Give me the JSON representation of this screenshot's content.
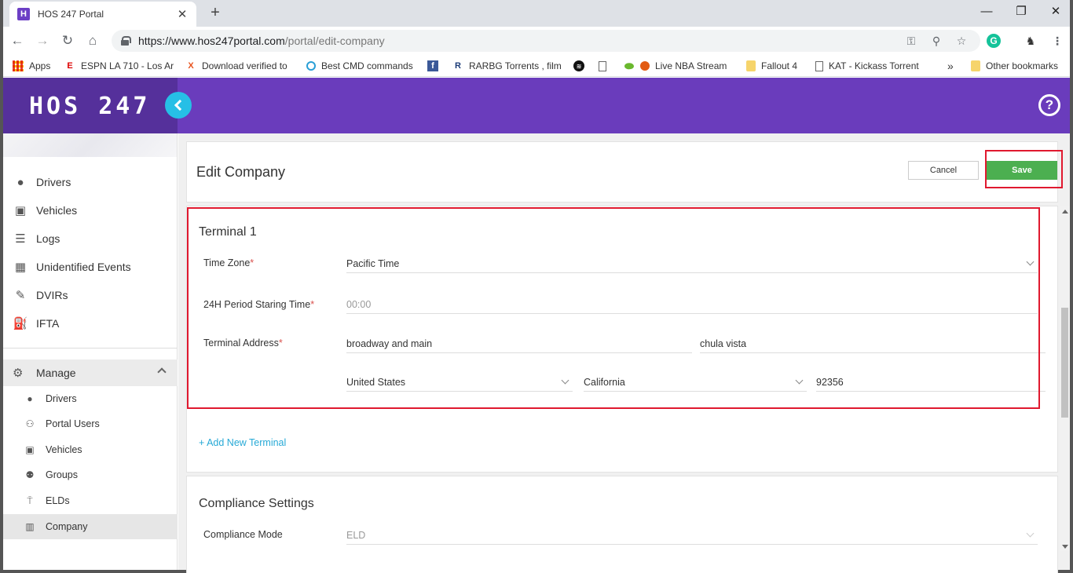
{
  "browser": {
    "tab_title": "HOS 247 Portal",
    "tab_favicon_letter": "H",
    "url_host": "https://www.hos247portal.com",
    "url_path": "/portal/edit-company",
    "bookmarks": [
      {
        "label": "Apps",
        "icon": "apps-grid-icon"
      },
      {
        "label": "ESPN LA 710 - Los Ar",
        "icon": "espn-icon"
      },
      {
        "label": "Download verified to",
        "icon": "x-icon"
      },
      {
        "label": "Best CMD commands",
        "icon": "cmd-icon"
      },
      {
        "label": "",
        "icon": "facebook-icon"
      },
      {
        "label": "RARBG Torrents , film",
        "icon": "rarbg-icon"
      },
      {
        "label": "",
        "icon": "spotify-icon"
      },
      {
        "label": "",
        "icon": "page-icon"
      },
      {
        "label": "Live NBA Stream",
        "icon": "nba-icon"
      },
      {
        "label": "Fallout 4",
        "icon": "folder-icon"
      },
      {
        "label": "KAT - Kickass Torrent",
        "icon": "page-icon"
      },
      {
        "label": "Other bookmarks",
        "icon": "folder-icon"
      }
    ],
    "more_bookmarks": "»"
  },
  "app": {
    "logo": "HOS 247",
    "help_symbol": "?"
  },
  "sidebar": {
    "items": [
      {
        "label": "Drivers",
        "icon": "person-icon"
      },
      {
        "label": "Vehicles",
        "icon": "bus-icon"
      },
      {
        "label": "Logs",
        "icon": "list-icon"
      },
      {
        "label": "Unidentified Events",
        "icon": "calendar-icon"
      },
      {
        "label": "DVIRs",
        "icon": "wrench-icon"
      },
      {
        "label": "IFTA",
        "icon": "fuel-pump-icon"
      }
    ],
    "manage": {
      "label": "Manage",
      "icon": "manage-gear-icon",
      "items": [
        {
          "label": "Drivers",
          "icon": "person-icon"
        },
        {
          "label": "Portal Users",
          "icon": "users-icon"
        },
        {
          "label": "Vehicles",
          "icon": "bus-icon"
        },
        {
          "label": "Groups",
          "icon": "group-icon"
        },
        {
          "label": "ELDs",
          "icon": "eld-device-icon"
        },
        {
          "label": "Company",
          "icon": "building-icon"
        }
      ]
    }
  },
  "header": {
    "title": "Edit Company",
    "cancel_label": "Cancel",
    "save_label": "Save"
  },
  "terminal": {
    "title": "Terminal 1",
    "time_zone_label": "Time Zone",
    "time_zone_value": "Pacific Time",
    "period_label": "24H Period Staring Time",
    "period_placeholder": "00:00",
    "address_label": "Terminal Address",
    "street": "broadway and main",
    "city": "chula vista",
    "country": "United States",
    "state": "California",
    "zip": "92356",
    "required_mark": "*"
  },
  "add_terminal_label": "+ Add New Terminal",
  "compliance": {
    "title": "Compliance Settings",
    "mode_label": "Compliance Mode",
    "mode_value": "ELD"
  }
}
